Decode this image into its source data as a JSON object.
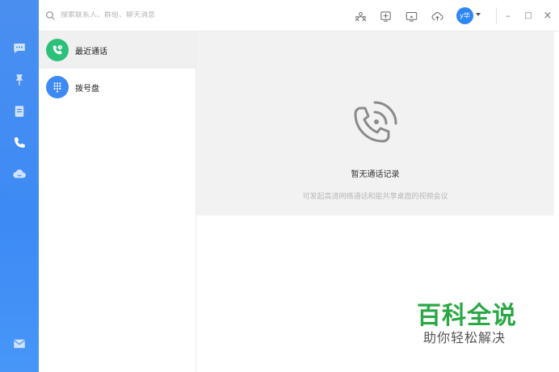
{
  "search": {
    "placeholder": "搜索联系人、群组、聊天消息"
  },
  "rail": {
    "items": [
      {
        "icon": "chat-icon"
      },
      {
        "icon": "pin-icon"
      },
      {
        "icon": "notebook-icon"
      },
      {
        "icon": "phone-icon"
      },
      {
        "icon": "cloud-icon"
      },
      {
        "icon": "mail-icon"
      }
    ]
  },
  "toolbar": {
    "tools": [
      {
        "icon": "contacts-icon"
      },
      {
        "icon": "add-icon"
      },
      {
        "icon": "screen-share-icon"
      },
      {
        "icon": "cloud-upload-icon"
      }
    ]
  },
  "user": {
    "avatar_text": "y华"
  },
  "window": {
    "minimize": "–",
    "maximize": "□",
    "close": "×"
  },
  "list": {
    "items": [
      {
        "label": "最近通话",
        "icon": "recent-call-icon",
        "color": "#2cc17b"
      },
      {
        "label": "拨号盘",
        "icon": "dialpad-icon",
        "color": "#3d8af5"
      }
    ]
  },
  "main": {
    "empty_title": "暂无通话记录",
    "empty_subtitle": "可发起高清网络通话和能共享桌面的视频会议"
  },
  "watermark": {
    "title": "百科全说",
    "subtitle": "助你轻松解决"
  },
  "colors": {
    "accent": "#3d8af5",
    "green": "#2cc17b"
  }
}
